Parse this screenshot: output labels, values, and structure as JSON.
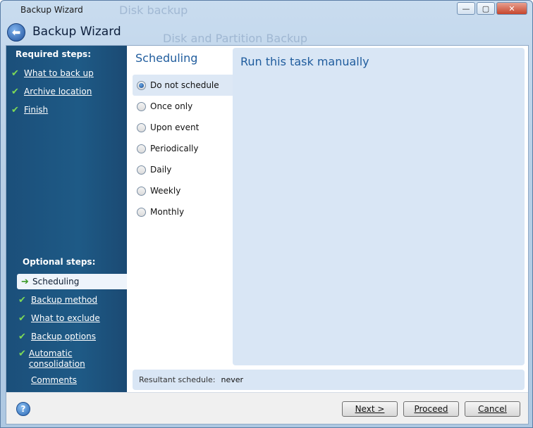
{
  "window": {
    "title": "Backup Wizard",
    "background_text_1": "Disk backup",
    "background_text_2": "Disk and Partition Backup",
    "controls": {
      "minimize": "—",
      "maximize": "▢",
      "close": "✕"
    }
  },
  "header": {
    "back_icon": "back-arrow-icon",
    "title": "Backup Wizard"
  },
  "sidebar": {
    "required_heading": "Required steps:",
    "required_items": [
      {
        "label": "What to back up",
        "icon": "check-icon"
      },
      {
        "label": "Archive location",
        "icon": "check-icon"
      },
      {
        "label": "Finish",
        "icon": "check-icon"
      }
    ],
    "optional_heading": "Optional steps:",
    "optional_items": [
      {
        "label": "Scheduling",
        "icon": "arrow-right-icon",
        "active": true
      },
      {
        "label": "Backup method",
        "icon": "check-icon"
      },
      {
        "label": "What to exclude",
        "icon": "check-icon"
      },
      {
        "label": "Backup options",
        "icon": "check-icon"
      },
      {
        "label": "Automatic consolidation",
        "icon": "check-icon"
      },
      {
        "label": "Comments",
        "icon": ""
      }
    ]
  },
  "scheduling": {
    "title": "Scheduling",
    "options": [
      {
        "label": "Do not schedule",
        "selected": true
      },
      {
        "label": "Once only",
        "selected": false
      },
      {
        "label": "Upon event",
        "selected": false
      },
      {
        "label": "Periodically",
        "selected": false
      },
      {
        "label": "Daily",
        "selected": false
      },
      {
        "label": "Weekly",
        "selected": false
      },
      {
        "label": "Monthly",
        "selected": false
      }
    ]
  },
  "panel": {
    "title": "Run this task manually"
  },
  "resultant": {
    "label": "Resultant schedule:",
    "value": "never"
  },
  "footer": {
    "next": "Next >",
    "proceed": "Proceed",
    "cancel": "Cancel"
  },
  "colors": {
    "sidebar": "#1e5a86",
    "accent": "#1f5c9d",
    "panel": "#d9e6f5",
    "check": "#7ed957"
  }
}
